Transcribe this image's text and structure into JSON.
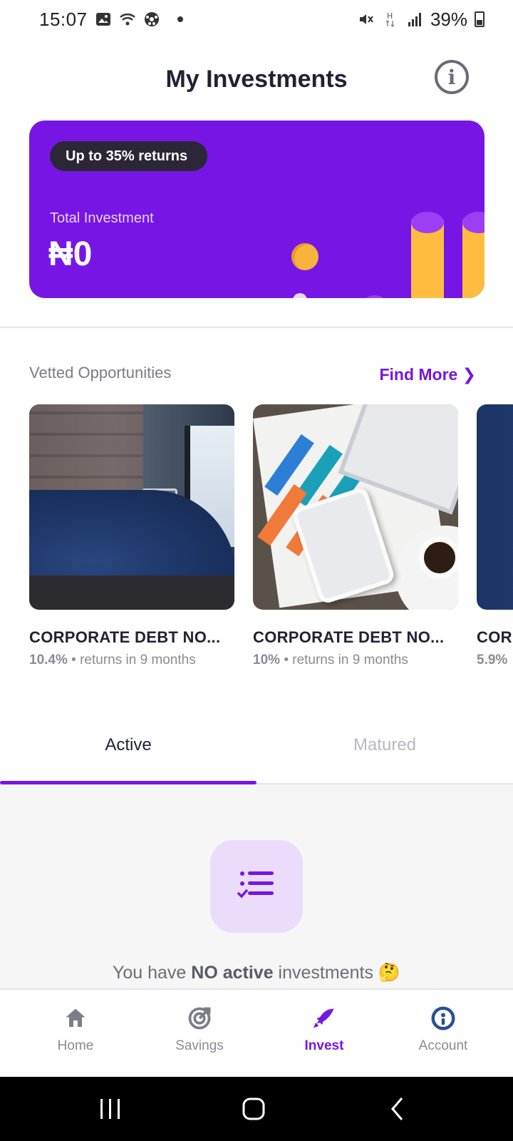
{
  "status_bar": {
    "time": "15:07",
    "battery": "39%",
    "left_icons": [
      "gallery-icon",
      "wifi-call-icon",
      "soccer-ball-icon"
    ],
    "right_icons": [
      "mute-icon",
      "data-h-icon",
      "signal-icon",
      "battery-icon"
    ]
  },
  "header": {
    "title": "My Investments",
    "info_icon": "info-icon"
  },
  "hero": {
    "pill": "Up to 35% returns",
    "label": "Total Investment",
    "amount": "₦0",
    "colors": {
      "background": "#7716e4",
      "pill": "#2b2738",
      "accent": "#ffbc3f"
    }
  },
  "vetted": {
    "title": "Vetted Opportunities",
    "find_more": "Find More ❯",
    "cards": [
      {
        "title": "CORPORATE DEBT NO...",
        "rate": "10.4%",
        "period": "• returns in 9 months"
      },
      {
        "title": "CORPORATE DEBT NO...",
        "rate": "10%",
        "period": "• returns in 9 months"
      },
      {
        "title": "COR",
        "rate": "5.9%",
        "period": ""
      }
    ]
  },
  "tabs": [
    {
      "label": "Active",
      "active": true
    },
    {
      "label": "Matured",
      "active": false
    }
  ],
  "empty_state": {
    "prefix": "You have ",
    "bold": "NO active",
    "suffix": " investments 🤔"
  },
  "bottom_nav": [
    {
      "label": "Home",
      "icon": "home-icon",
      "active": false
    },
    {
      "label": "Savings",
      "icon": "target-icon",
      "active": false
    },
    {
      "label": "Invest",
      "icon": "rocket-icon",
      "active": true
    },
    {
      "label": "Account",
      "icon": "account-icon",
      "active": false
    }
  ],
  "colors": {
    "brand": "#7716e4",
    "text": "#1f2233",
    "muted": "#8b8b95"
  }
}
